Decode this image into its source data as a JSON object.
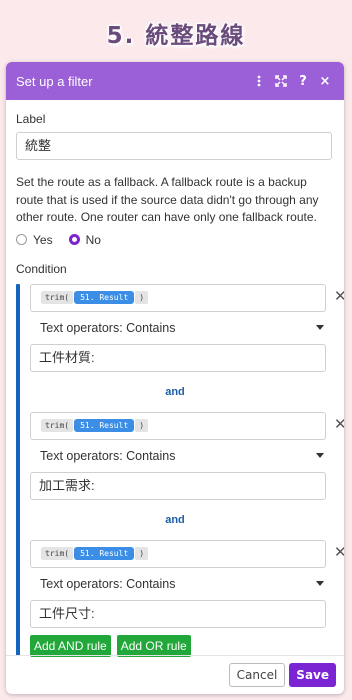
{
  "page_title": "5. 統整路線",
  "dialog": {
    "title": "Set up a filter",
    "header_icons": [
      "more-vertical-icon",
      "expand-icon",
      "help-icon",
      "close-icon"
    ],
    "help_glyph": "?",
    "close_glyph": "×"
  },
  "label_section": {
    "label": "Label",
    "value": "統整"
  },
  "fallback": {
    "description": "Set the route as a fallback. A fallback route is a backup route that is used if the source data didn't go through any other route. One router can have only one fallback route.",
    "options": [
      "Yes",
      "No"
    ],
    "selected": "No"
  },
  "condition": {
    "label": "Condition",
    "conditions": [
      {
        "fn": "trim(",
        "var": "51. Result",
        "close": ")",
        "operator": "Text operators: Contains",
        "value": "工件材質:"
      },
      {
        "fn": "trim(",
        "var": "51. Result",
        "close": ")",
        "operator": "Text operators: Contains",
        "value": "加工需求:"
      },
      {
        "fn": "trim(",
        "var": "51. Result",
        "close": ")",
        "operator": "Text operators: Contains",
        "value": "工件尺寸:"
      }
    ],
    "connector": "and",
    "remove_glyph": "✕"
  },
  "rule_buttons": {
    "add_and": "Add AND rule",
    "add_or": "Add OR rule"
  },
  "footer": {
    "cancel": "Cancel",
    "save": "Save"
  },
  "colors": {
    "header": "#9b5fd8",
    "accent": "#7a24d4",
    "condition_bar": "#1565c0",
    "variable_pill": "#3b8de6",
    "rule_button": "#22a83a",
    "background": "#fbe9ec"
  }
}
